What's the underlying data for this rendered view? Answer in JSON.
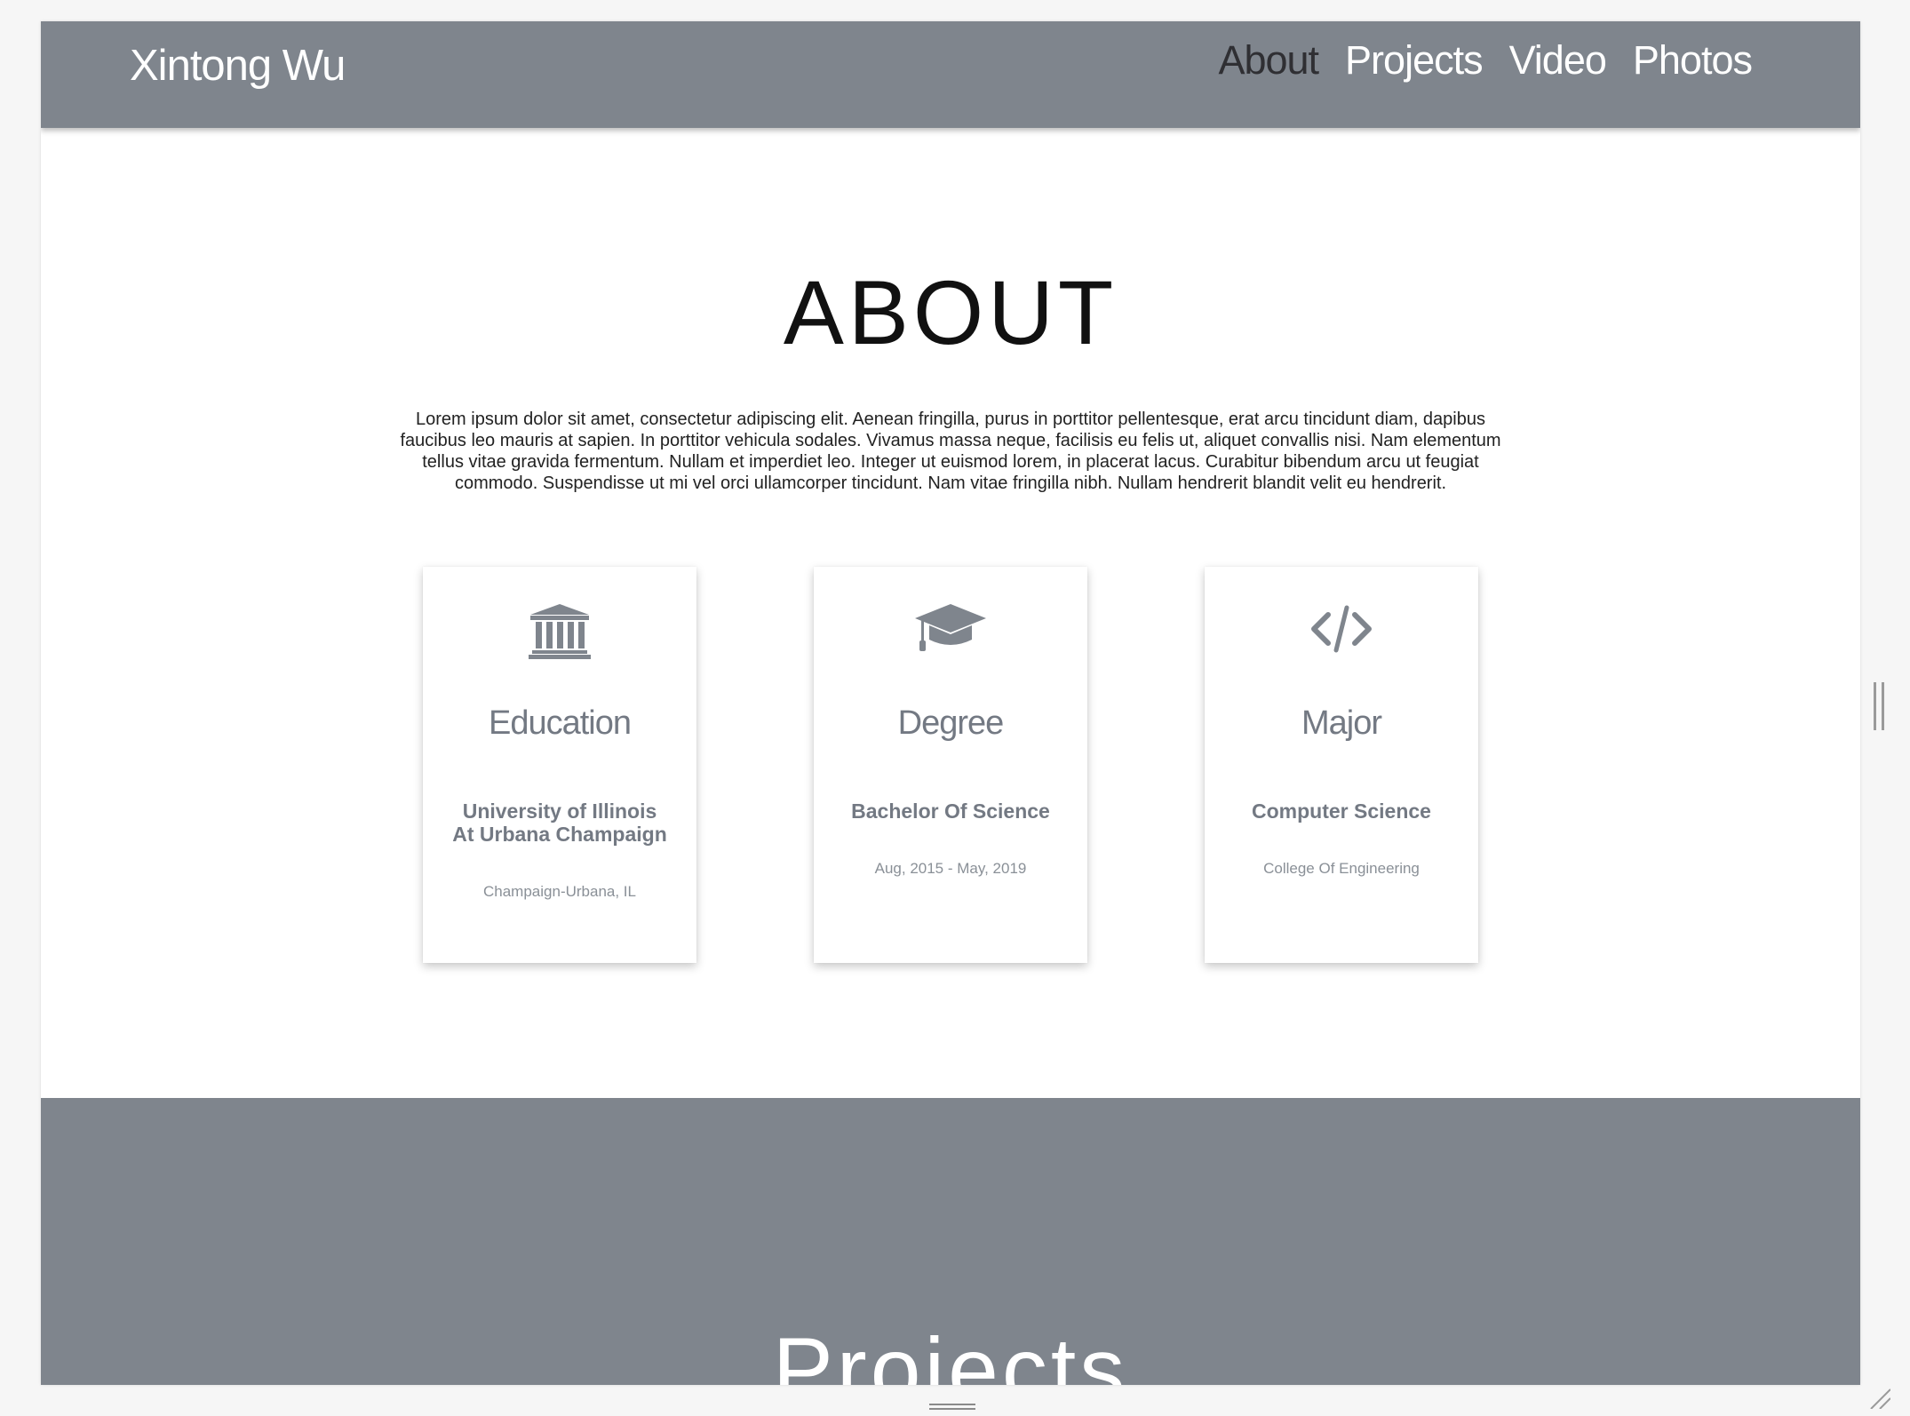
{
  "nav": {
    "brand": "Xintong Wu",
    "links": [
      "About",
      "Projects",
      "Video",
      "Photos"
    ],
    "active": "About"
  },
  "about": {
    "title": "ABOUT",
    "text": "Lorem ipsum dolor sit amet, consectetur adipiscing elit. Aenean fringilla, purus in porttitor pellentesque, erat arcu tincidunt diam, dapibus faucibus leo mauris at sapien. In porttitor vehicula sodales. Vivamus massa neque, facilisis eu felis ut, aliquet convallis nisi. Nam elementum tellus vitae gravida fermentum. Nullam et imperdiet leo. Integer ut euismod lorem, in placerat lacus. Curabitur bibendum arcu ut feugiat commodo. Suspendisse ut mi vel orci ullamcorper tincidunt. Nam vitae fringilla nibh. Nullam hendrerit blandit velit eu hendrerit."
  },
  "cards": [
    {
      "icon": "institution-icon",
      "title": "Education",
      "primary": "University of Illinois\nAt Urbana Champaign",
      "secondary": "Champaign-Urbana, IL"
    },
    {
      "icon": "graduation-cap-icon",
      "title": "Degree",
      "primary": "Bachelor Of Science",
      "secondary": "Aug, 2015 - May, 2019"
    },
    {
      "icon": "code-icon",
      "title": "Major",
      "primary": "Computer Science",
      "secondary": "College Of Engineering"
    }
  ],
  "projects": {
    "title": "Projects"
  },
  "colors": {
    "accent_gray": "#7f858d",
    "active_link": "#2f2f33",
    "background": "#ffffff"
  }
}
